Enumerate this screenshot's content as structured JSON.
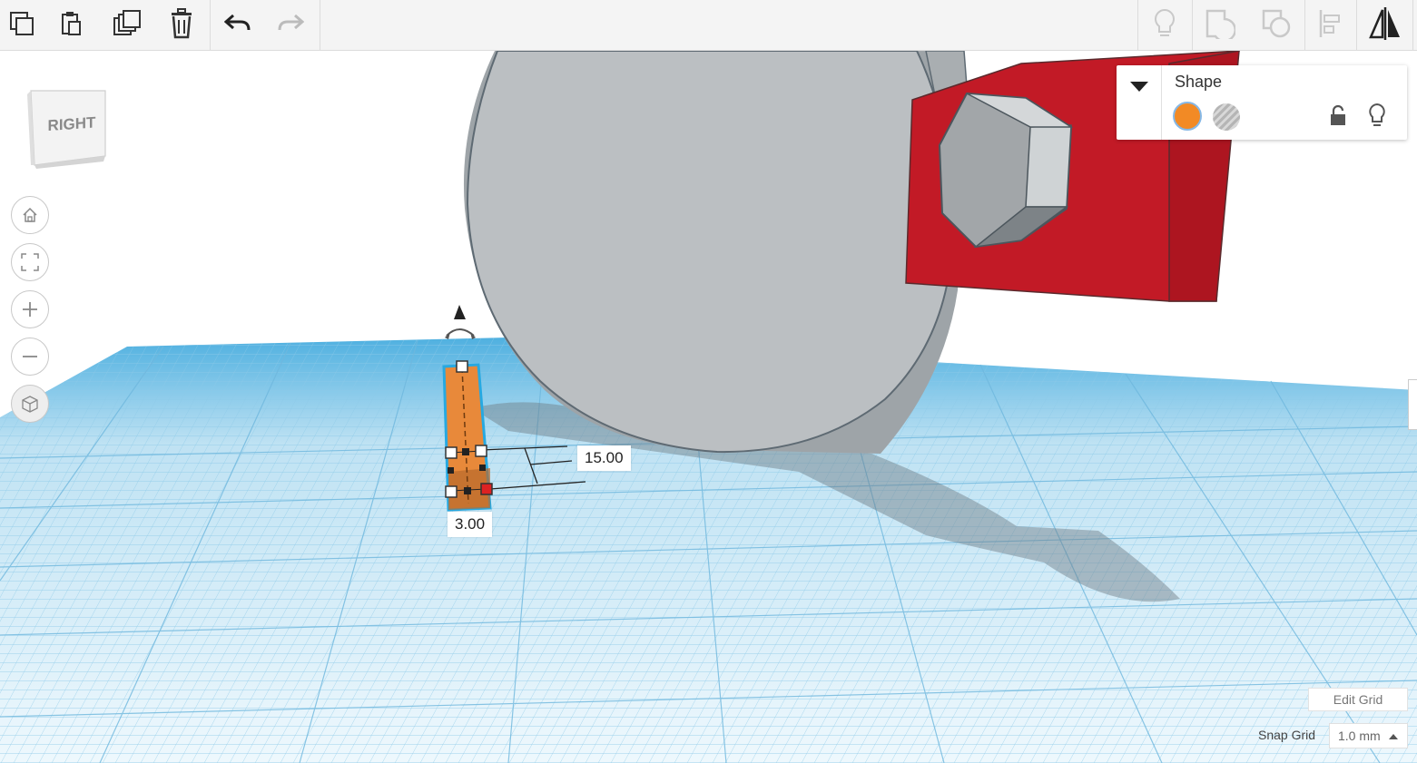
{
  "toolbar": {
    "left_tools": [
      "copy-icon",
      "paste-icon",
      "duplicate-icon",
      "delete-icon",
      "undo-icon",
      "redo-icon"
    ],
    "right_tools": [
      "lightbulb-icon",
      "group-icon",
      "ungroup-icon",
      "align-icon",
      "mirror-icon"
    ]
  },
  "viewcube": {
    "face_label": "RIGHT"
  },
  "nav": [
    "home-icon",
    "fit-view-icon",
    "zoom-in-icon",
    "zoom-out-icon",
    "perspective-icon"
  ],
  "shape_panel": {
    "title": "Shape",
    "solid_color": "#f28a25",
    "icons": [
      "lock-icon",
      "lightbulb-icon"
    ]
  },
  "dimensions": {
    "height": "15.00",
    "width": "3.00"
  },
  "grid": {
    "edit_label": "Edit Grid",
    "snap_label": "Snap Grid",
    "snap_value": "1.0 mm"
  },
  "colors": {
    "accent_red": "#c21a26",
    "selected_shape": "#e8893a",
    "grid_blue": "#7cc3e6"
  }
}
